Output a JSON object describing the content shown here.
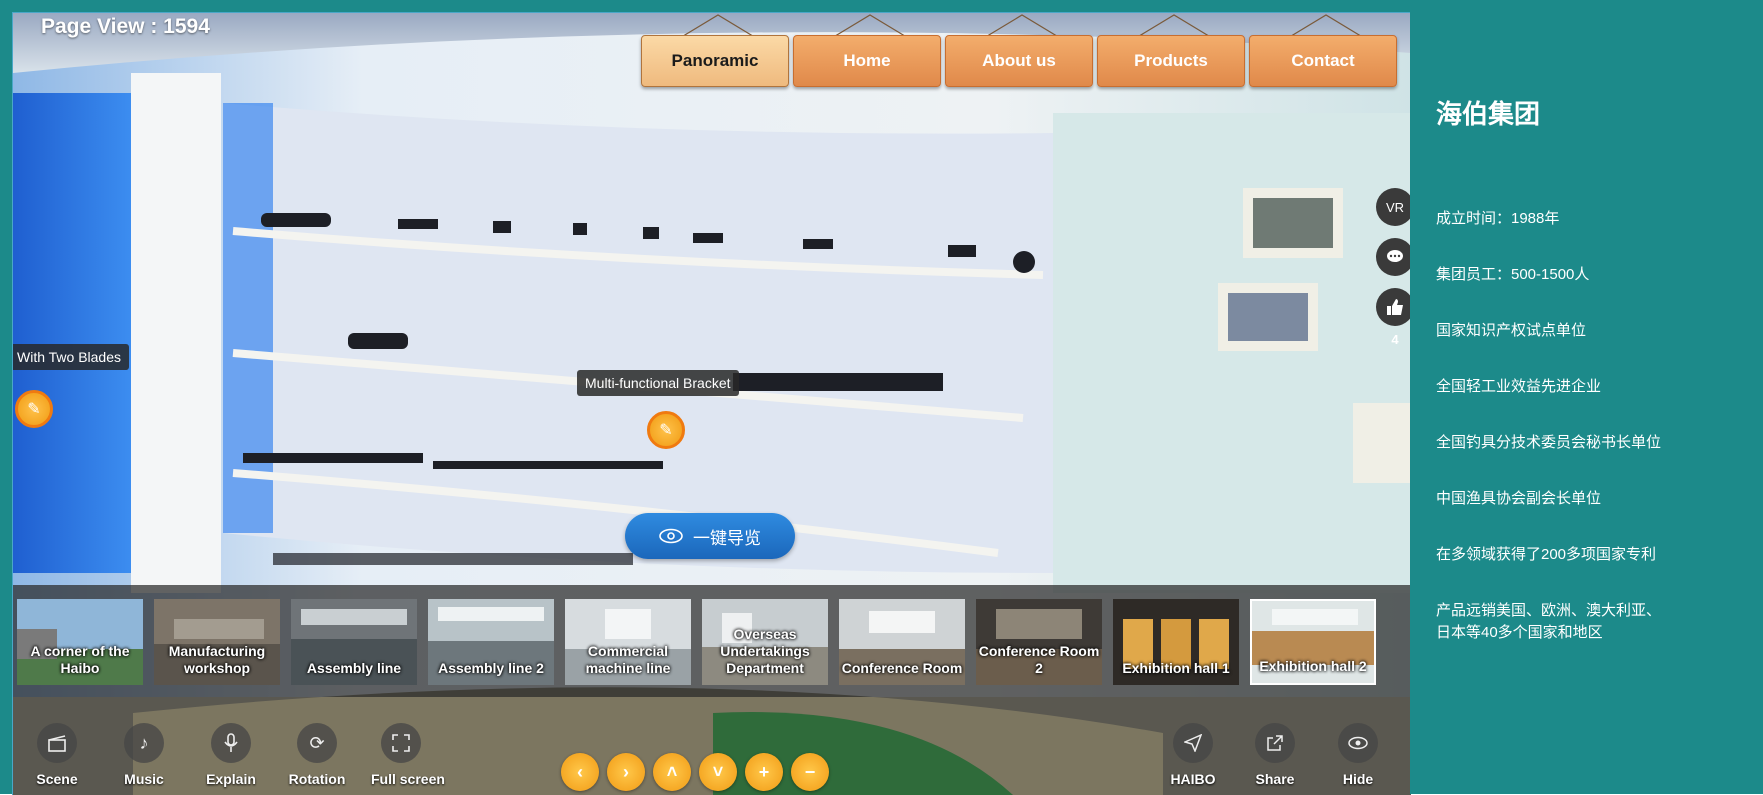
{
  "page_view": "Page View : 1594",
  "nav": {
    "items": [
      {
        "label": "Panoramic",
        "active": true
      },
      {
        "label": "Home",
        "active": false
      },
      {
        "label": "About us",
        "active": false
      },
      {
        "label": "Products",
        "active": false
      },
      {
        "label": "Contact",
        "active": false
      }
    ]
  },
  "side_tools": {
    "vr_label": "VR",
    "like_count": "4",
    "icons": [
      "vr-icon",
      "comment-icon",
      "thumbs-up-icon"
    ]
  },
  "hotspots": {
    "left_label": "With Two Blades",
    "center_label": "Multi-functional Bracket",
    "icon": "pen-icon"
  },
  "guide_button": {
    "label": "一键导览",
    "icon": "eye-icon"
  },
  "scenes": [
    {
      "label": "A corner of the Haibo",
      "selected": false
    },
    {
      "label": "Manufacturing workshop",
      "selected": false
    },
    {
      "label": "Assembly line",
      "selected": false
    },
    {
      "label": "Assembly line 2",
      "selected": false
    },
    {
      "label": "Commercial machine line",
      "selected": false
    },
    {
      "label": "Overseas Undertakings Department",
      "selected": false
    },
    {
      "label": "Conference Room",
      "selected": false
    },
    {
      "label": "Conference Room 2",
      "selected": false
    },
    {
      "label": "Exhibition hall 1",
      "selected": false
    },
    {
      "label": "Exhibition hall 2",
      "selected": true
    }
  ],
  "controls_left": [
    {
      "label": "Scene",
      "icon": "clapperboard-icon"
    },
    {
      "label": "Music",
      "icon": "music-note-icon"
    },
    {
      "label": "Explain",
      "icon": "microphone-icon"
    },
    {
      "label": "Rotation",
      "icon": "rotation-icon"
    },
    {
      "label": "Full screen",
      "icon": "fullscreen-icon"
    }
  ],
  "controls_right": [
    {
      "label": "HAIBO",
      "icon": "paper-plane-icon"
    },
    {
      "label": "Share",
      "icon": "share-icon"
    },
    {
      "label": "Hide",
      "icon": "eye-hide-icon"
    }
  ],
  "view_controls": [
    "arrow-left-icon",
    "arrow-right-icon",
    "arrow-up-icon",
    "arrow-down-icon",
    "zoom-in-icon",
    "zoom-out-icon"
  ],
  "info": {
    "title": "海伯集团",
    "facts": [
      "成立时间：1988年",
      "集团员工：500-1500人",
      "国家知识产权试点单位",
      "全国轻工业效益先进企业",
      "全国钓具分技术委员会秘书长单位",
      "中国渔具协会副会长单位",
      "在多领域获得了200多项国家专利",
      "产品远销美国、欧洲、澳大利亚、\n日本等40多个国家和地区"
    ]
  }
}
